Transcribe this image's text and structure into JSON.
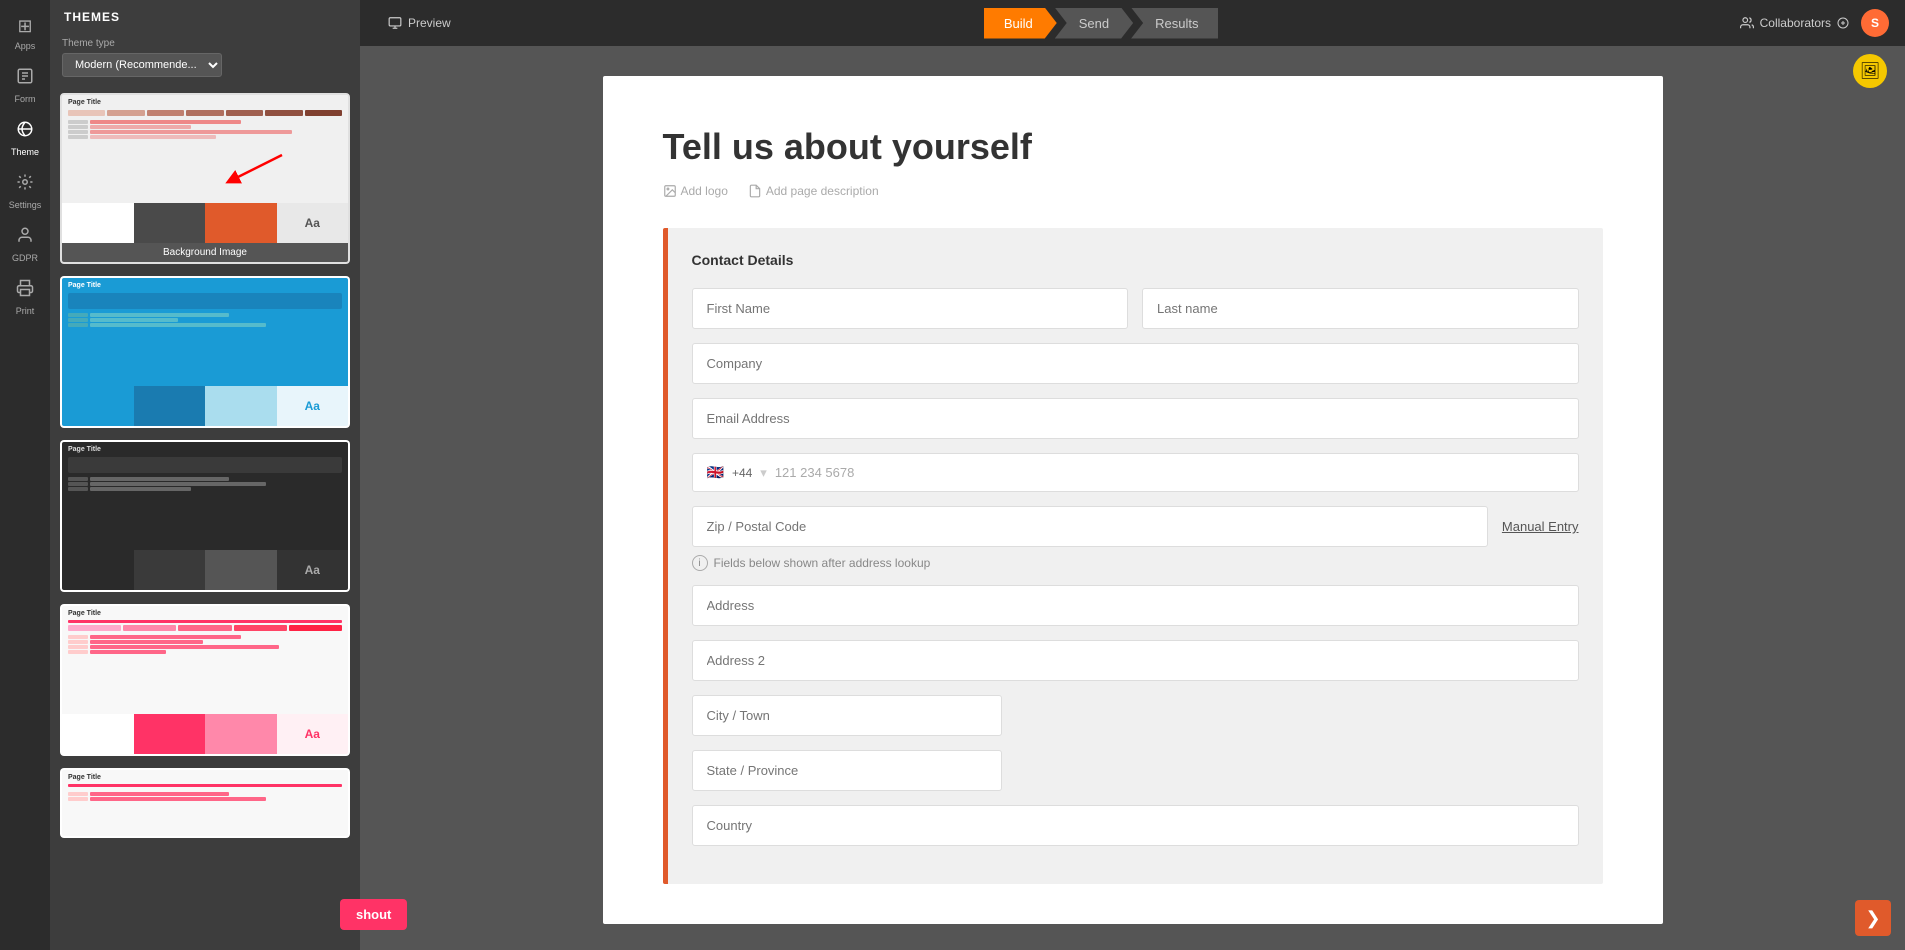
{
  "app": {
    "title": "THEMES"
  },
  "sidebar": {
    "items": [
      {
        "id": "apps",
        "label": "Apps",
        "icon": "⊞"
      },
      {
        "id": "form",
        "label": "Form",
        "icon": "📋"
      },
      {
        "id": "theme",
        "label": "Theme",
        "icon": "🎨",
        "active": true
      },
      {
        "id": "settings",
        "label": "Settings",
        "icon": "⚙"
      },
      {
        "id": "gdpr",
        "label": "GDPR",
        "icon": "👤"
      },
      {
        "id": "print",
        "label": "Print",
        "icon": "🖨"
      }
    ]
  },
  "themes_panel": {
    "header": "THEMES",
    "theme_type_label": "Theme type",
    "theme_type_value": "Modern (Recommende...",
    "themes": [
      {
        "id": 1,
        "label": "Background Image",
        "selected": true
      },
      {
        "id": 2,
        "label": "Page Title",
        "style": "blue"
      },
      {
        "id": 3,
        "label": "Page Title",
        "style": "dark"
      },
      {
        "id": 4,
        "label": "Page Title",
        "style": "pink"
      },
      {
        "id": 5,
        "label": "Page Title",
        "style": "white-partial"
      }
    ]
  },
  "topbar": {
    "preview_label": "Preview",
    "steps": [
      {
        "id": "build",
        "label": "Build",
        "active": true
      },
      {
        "id": "send",
        "label": "Send",
        "active": false
      },
      {
        "id": "results",
        "label": "Results",
        "active": false
      }
    ],
    "collaborators_label": "Collaborators"
  },
  "form": {
    "page_title": "Tell us about yourself",
    "add_logo": "Add logo",
    "add_description": "Add page description",
    "section_title": "Contact Details",
    "fields": {
      "first_name_placeholder": "First Name",
      "last_name_placeholder": "Last name",
      "company_placeholder": "Company",
      "email_placeholder": "Email Address",
      "phone_code": "+44",
      "phone_number": "121 234 5678",
      "zip_placeholder": "Zip / Postal Code",
      "manual_entry": "Manual Entry",
      "address_info": "Fields below shown after address lookup",
      "address_placeholder": "Address",
      "address2_placeholder": "Address 2",
      "city_placeholder": "City / Town",
      "state_placeholder": "State / Province",
      "country_placeholder": "Country"
    }
  },
  "shout": {
    "label": "shout"
  },
  "image_icon": "🖼",
  "next_icon": "❯"
}
